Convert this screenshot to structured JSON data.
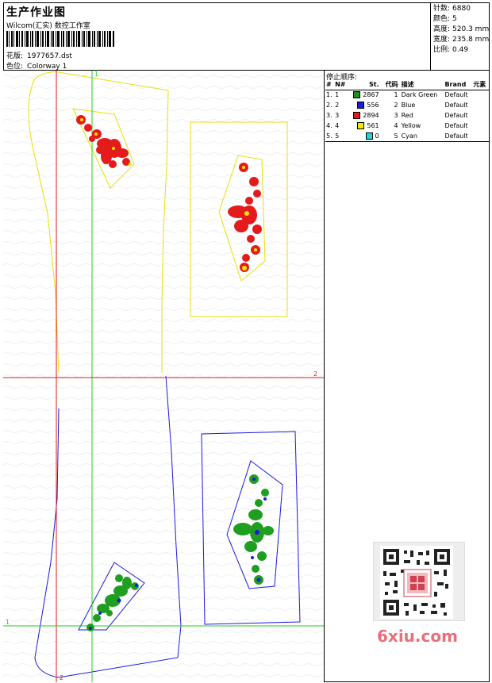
{
  "header": {
    "title": "生产作业图",
    "company": "Wilcom(汇实) 数控工作室",
    "design_label": "花版:",
    "design_value": "1977657.dst",
    "color_label": "色位:",
    "color_value": "Colorway 1"
  },
  "stats": [
    {
      "label": "针数:",
      "value": "6880"
    },
    {
      "label": "颜色:",
      "value": "5"
    },
    {
      "label": "高度:",
      "value": "520.3 mm"
    },
    {
      "label": "宽度:",
      "value": "235.8 mm"
    },
    {
      "label": "比例:",
      "value": "0.49"
    }
  ],
  "stop_sequence": {
    "title": "停止顺序:",
    "columns": [
      "#",
      "N#",
      "St.",
      "代码",
      "描述",
      "Brand",
      "元素"
    ],
    "rows": [
      {
        "idx": "1.",
        "n": "1",
        "color": "#1f8f1f",
        "st": "2867",
        "code": "1",
        "desc": "Dark Green",
        "brand": "Default"
      },
      {
        "idx": "2.",
        "n": "2",
        "color": "#1a1adb",
        "st": "556",
        "code": "2",
        "desc": "Blue",
        "brand": "Default"
      },
      {
        "idx": "3.",
        "n": "3",
        "color": "#e51a1a",
        "st": "2894",
        "code": "3",
        "desc": "Red",
        "brand": "Default"
      },
      {
        "idx": "4.",
        "n": "4",
        "color": "#f3e600",
        "st": "561",
        "code": "4",
        "desc": "Yellow",
        "brand": "Default"
      },
      {
        "idx": "5.",
        "n": "5",
        "color": "#2ad1d1",
        "st": "0",
        "code": "5",
        "desc": "Cyan",
        "brand": "Default"
      }
    ]
  },
  "canvas": {
    "marker_1_top": "1",
    "marker_2_right": "2",
    "marker_1_left": "1",
    "marker_2_bottom": "2",
    "colors": {
      "yellow_outline": "#e8e000",
      "blue_outline": "#1a1adb",
      "red_guide": "#e51a1a",
      "green_guide": "#22cc22"
    }
  },
  "watermark": {
    "text": "6xiu.com"
  }
}
